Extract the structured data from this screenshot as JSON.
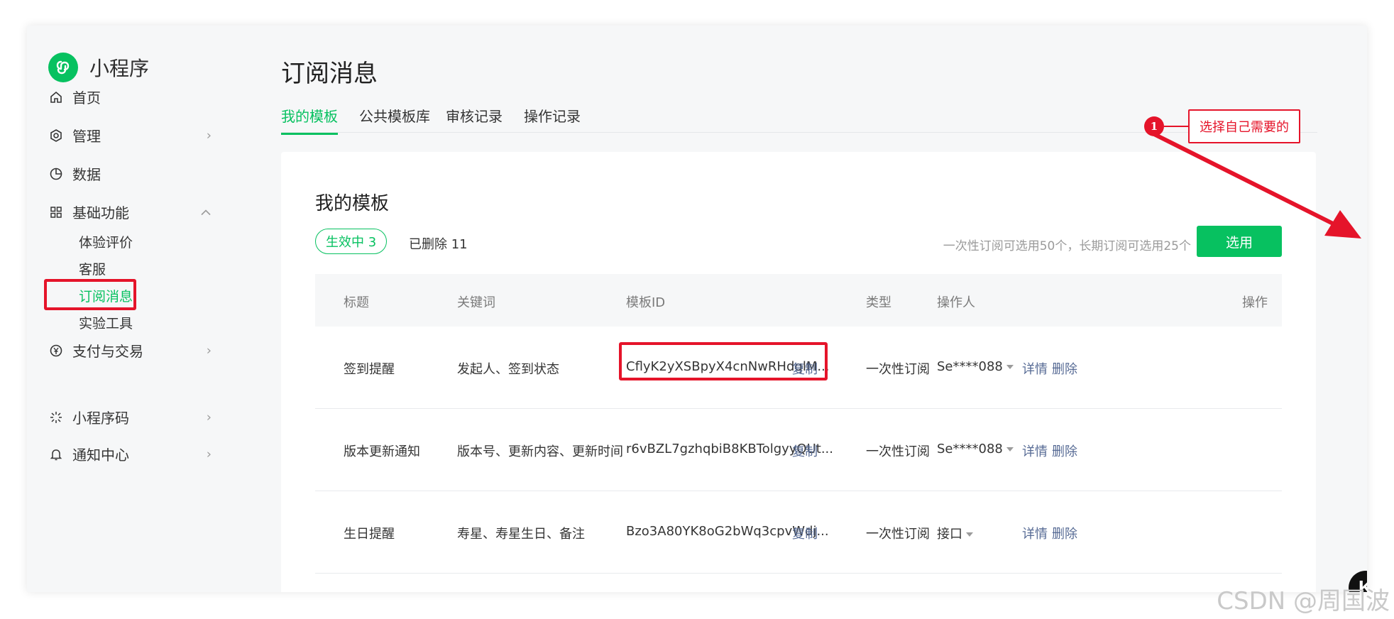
{
  "app": {
    "name": "小程序"
  },
  "sidebar": {
    "items": [
      {
        "label": "首页",
        "icon": "home-icon"
      },
      {
        "label": "管理",
        "icon": "settings-hex-icon"
      },
      {
        "label": "数据",
        "icon": "pie-chart-icon"
      },
      {
        "label": "基础功能",
        "icon": "grid-icon"
      },
      {
        "label": "支付与交易",
        "icon": "yen-icon"
      },
      {
        "label": "小程序码",
        "icon": "qrcode-burst-icon"
      },
      {
        "label": "通知中心",
        "icon": "bell-icon"
      }
    ],
    "sub_items": [
      "体验评价",
      "客服",
      "订阅消息",
      "实验工具"
    ]
  },
  "page": {
    "title": "订阅消息",
    "tabs": [
      "我的模板",
      "公共模板库",
      "审核记录",
      "操作记录"
    ]
  },
  "card": {
    "title": "我的模板",
    "active_filter": "生效中 3",
    "deleted_filter": "已删除 11",
    "hint": "一次性订阅可选用50个，长期订阅可选用25个",
    "select_button": "选用"
  },
  "table": {
    "headers": [
      "标题",
      "关键词",
      "模板ID",
      "类型",
      "操作人",
      "操作"
    ],
    "copy_label": "复制",
    "detail_label": "详情",
    "delete_label": "删除",
    "rows": [
      {
        "title": "签到提醒",
        "keywords": "发起人、签到状态",
        "template_id": "CflyK2yXSBpyX4cnNwRHdqlM...",
        "type": "一次性订阅",
        "operator": "Se****088"
      },
      {
        "title": "版本更新通知",
        "keywords": "版本号、更新内容、更新时间",
        "template_id": "r6vBZL7gzhqbiB8KBTolgyyQUt...",
        "type": "一次性订阅",
        "operator": "Se****088"
      },
      {
        "title": "生日提醒",
        "keywords": "寿星、寿星生日、备注",
        "template_id": "Bzo3A80YK8oG2bWq3cpvWdj...",
        "type": "一次性订阅",
        "operator": "接口"
      }
    ]
  },
  "annotation": {
    "number": "1",
    "text": "选择自己需要的"
  },
  "badge": {
    "letter": "K"
  },
  "watermark": "CSDN @周国波",
  "colors": {
    "brand_green": "#07c160",
    "annotation_red": "#e5142a",
    "link_blue": "#576b95"
  }
}
